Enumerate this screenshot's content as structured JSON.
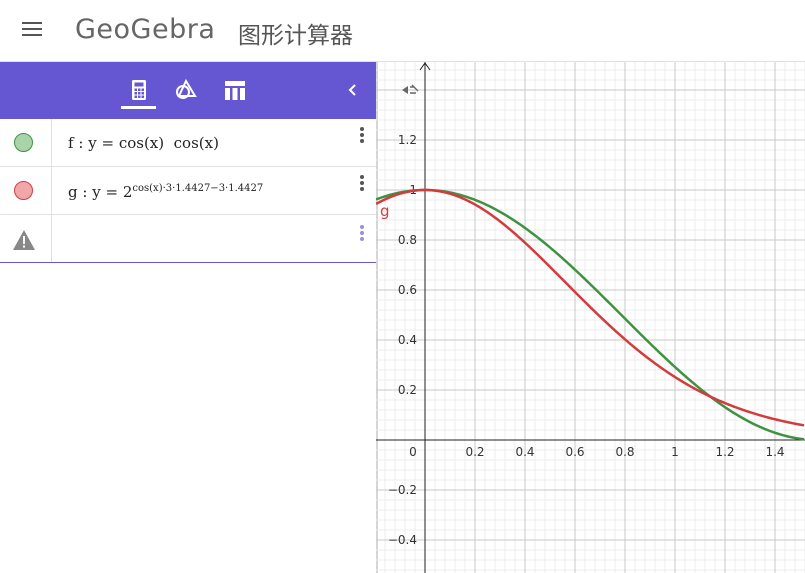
{
  "header": {
    "brand": "GeoGebra",
    "subtitle": "图形计算器"
  },
  "algebra": {
    "rows": [
      {
        "color": "#3f9240",
        "fill": "#a9d3a9",
        "f_name": "f",
        "colon": ":",
        "y": "y",
        "eq": "=",
        "expr": "cos(x)  cos(x)"
      },
      {
        "color": "#d33c3c",
        "fill": "#efa7a7",
        "g_name": "g",
        "colon": ":",
        "y": "y",
        "eq": "=",
        "base": "2",
        "exponent": "cos(x)·3·1.4427−3·1.4427"
      }
    ]
  },
  "graph": {
    "x_ticks": [
      "0",
      "0.2",
      "0.4",
      "0.6",
      "0.8",
      "1",
      "1.2",
      "1.4"
    ],
    "y_ticks": [
      "1.2",
      "1",
      "0.8",
      "0.6",
      "0.4",
      "0.2",
      "−0.2",
      "−0.4"
    ],
    "curve_label": "g",
    "curves": [
      {
        "name": "f",
        "color": "#3f9240"
      },
      {
        "name": "g",
        "color": "#d33c3c"
      }
    ]
  }
}
